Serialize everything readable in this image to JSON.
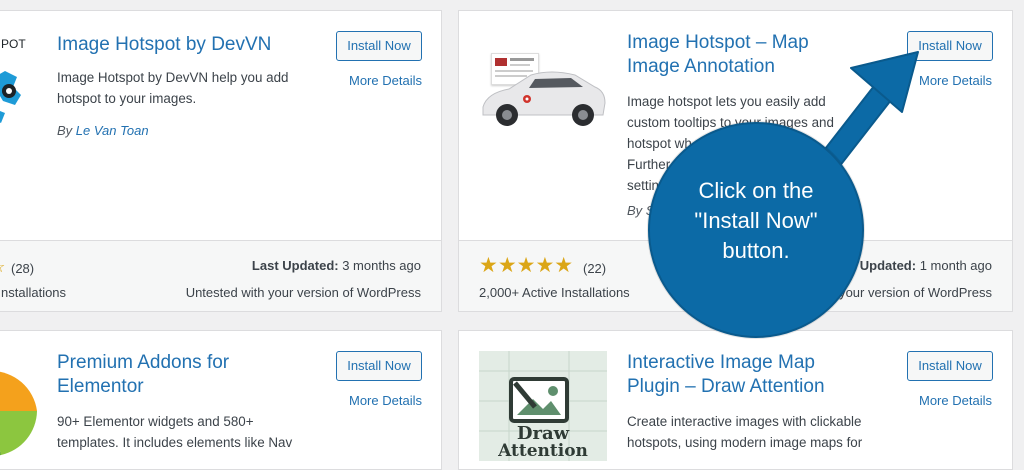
{
  "cards": [
    {
      "title": "Image Hotspot by DevVN",
      "thumb_text": "POT",
      "description": "Image Hotspot by DevVN help you add hotspot to your images.",
      "author_prefix": "By",
      "author": "Le Van Toan",
      "install_label": "Install Now",
      "more_label": "More Details",
      "rating_count": "(28)",
      "installs": "nstallations",
      "last_updated_label": "Last Updated:",
      "last_updated_value": "3 months ago",
      "compat": "Untested with your version of WordPress"
    },
    {
      "title_line1": "Image Hotspot – Map",
      "title_line2": "Image Annotation",
      "description_lines": [
        "Image hotspot lets you easily add",
        "custom tooltips to your images and",
        "hotspot wh",
        "Further",
        "settin"
      ],
      "author_prefix": "By S",
      "install_label": "Install Now",
      "more_label": "More Details",
      "rating_value": 5,
      "rating_count": "(22)",
      "installs": "2,000+ Active Installations",
      "last_updated_label": "Updated:",
      "last_updated_value": "1 month ago",
      "compat": "your version of WordPress"
    },
    {
      "title_line1": "Premium Addons for",
      "title_line2": "Elementor",
      "description_lines": [
        "90+ Elementor widgets and 580+",
        "templates. It includes elements like Nav"
      ],
      "install_label": "Install Now",
      "more_label": "More Details"
    },
    {
      "title_line1": "Interactive Image Map",
      "title_line2": "Plugin – Draw Attention",
      "thumb_text_1": "Draw",
      "thumb_text_2": "Attention",
      "description_lines": [
        "Create interactive images with clickable",
        "hotspots, using modern image maps for"
      ],
      "install_label": "Install Now",
      "more_label": "More Details"
    }
  ],
  "callout": {
    "line1": "Click on the",
    "line2": "\"Install Now\"",
    "line3": "button."
  },
  "colors": {
    "link": "#2271b1",
    "callout": "#0c6aa6",
    "star": "#dba617"
  }
}
